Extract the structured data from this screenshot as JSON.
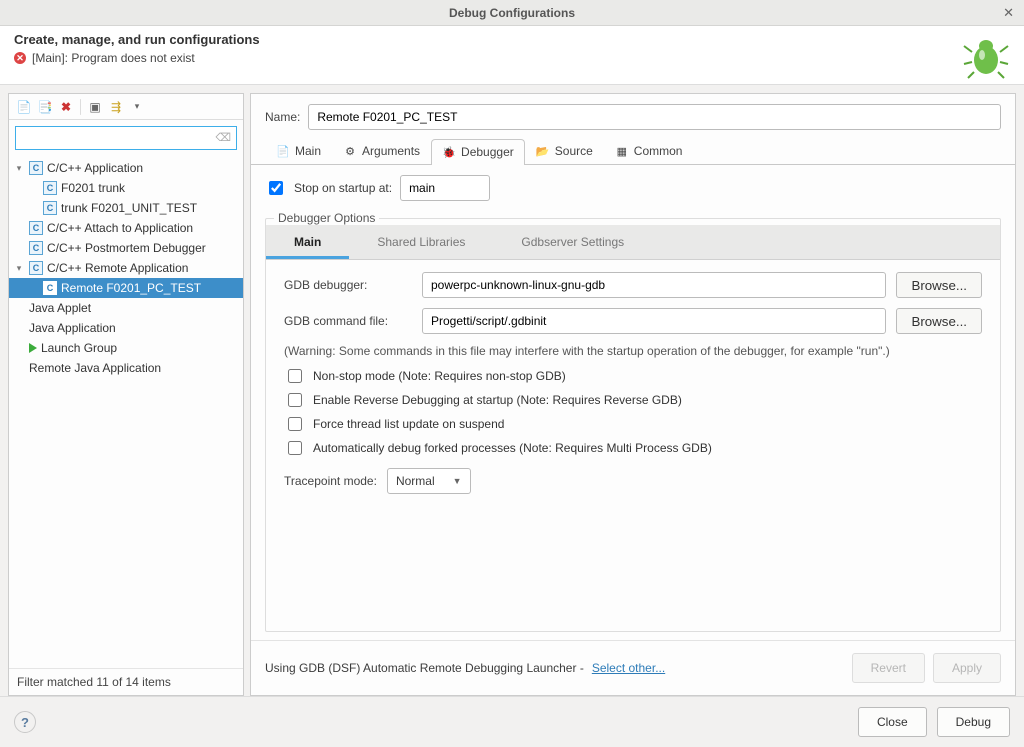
{
  "window": {
    "title": "Debug Configurations"
  },
  "header": {
    "heading": "Create, manage, and run configurations",
    "error": "[Main]: Program does not exist"
  },
  "tree": {
    "filter_count": "Filter matched 11 of 14 items",
    "items": [
      {
        "label": "C/C++ Application",
        "level": 0,
        "icon": "c",
        "twisty": "down"
      },
      {
        "label": "F0201 trunk",
        "level": 1,
        "icon": "c"
      },
      {
        "label": "trunk F0201_UNIT_TEST",
        "level": 1,
        "icon": "c"
      },
      {
        "label": "C/C++ Attach to Application",
        "level": 0,
        "icon": "c"
      },
      {
        "label": "C/C++ Postmortem Debugger",
        "level": 0,
        "icon": "c"
      },
      {
        "label": "C/C++ Remote Application",
        "level": 0,
        "icon": "c",
        "twisty": "down"
      },
      {
        "label": "Remote F0201_PC_TEST",
        "level": 1,
        "icon": "c",
        "selected": true
      },
      {
        "label": "Java Applet",
        "level": 0
      },
      {
        "label": "Java Application",
        "level": 0
      },
      {
        "label": "Launch Group",
        "level": 0,
        "icon": "play"
      },
      {
        "label": "Remote Java Application",
        "level": 0
      }
    ]
  },
  "config": {
    "name_label": "Name:",
    "name_value": "Remote F0201_PC_TEST",
    "tabs": [
      {
        "label": "Main"
      },
      {
        "label": "Arguments"
      },
      {
        "label": "Debugger",
        "active": true
      },
      {
        "label": "Source"
      },
      {
        "label": "Common"
      }
    ],
    "stop_on_startup_label": "Stop on startup at:",
    "stop_on_startup_checked": true,
    "stop_on_startup_value": "main",
    "options_legend": "Debugger Options",
    "subtabs": [
      {
        "label": "Main",
        "active": true
      },
      {
        "label": "Shared Libraries"
      },
      {
        "label": "Gdbserver Settings"
      }
    ],
    "gdb_debugger_label": "GDB debugger:",
    "gdb_debugger_value": "powerpc-unknown-linux-gnu-gdb",
    "gdb_cmdfile_label": "GDB command file:",
    "gdb_cmdfile_value": "Progetti/script/.gdbinit",
    "browse_label": "Browse...",
    "warning": "(Warning: Some commands in this file may interfere with the startup operation of the debugger, for example \"run\".)",
    "cb_nonstop": "Non-stop mode (Note: Requires non-stop GDB)",
    "cb_reverse": "Enable Reverse Debugging at startup (Note: Requires Reverse GDB)",
    "cb_threadlist": "Force thread list update on suspend",
    "cb_autofork": "Automatically debug forked processes (Note: Requires Multi Process GDB)",
    "tracemode_label": "Tracepoint mode:",
    "tracemode_value": "Normal",
    "launcher_text": "Using GDB (DSF) Automatic Remote Debugging Launcher - ",
    "launcher_link": "Select other...",
    "btn_revert": "Revert",
    "btn_apply": "Apply"
  },
  "footer": {
    "btn_close": "Close",
    "btn_debug": "Debug"
  }
}
